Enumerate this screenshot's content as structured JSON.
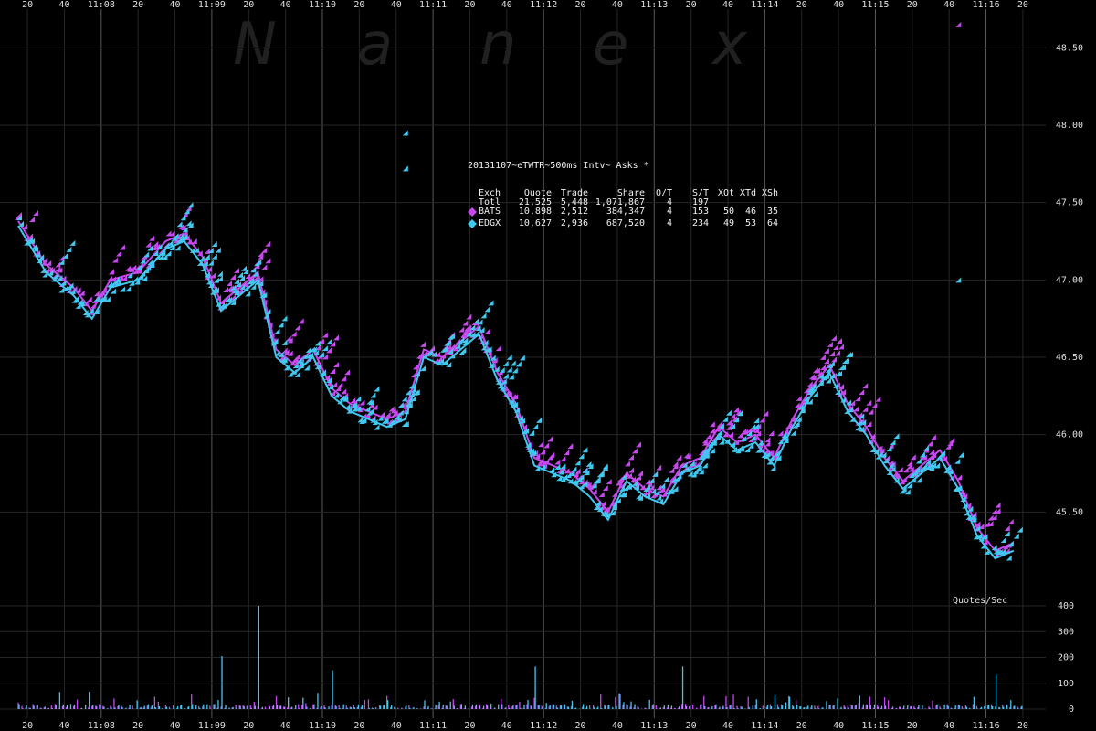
{
  "watermark": [
    "N",
    "a",
    "n",
    "e",
    "x"
  ],
  "chart_data": {
    "type": "scatter",
    "title": "20131107~eTWTR~500ms Intv~ Asks *",
    "price_axis": {
      "ticks": [
        "48.50",
        "48.00",
        "47.50",
        "47.00",
        "46.50",
        "46.00",
        "45.50"
      ],
      "range": [
        45.0,
        48.75
      ]
    },
    "volume_axis": {
      "label": "Quotes/Sec",
      "ticks": [
        "400",
        "300",
        "200",
        "100",
        "0"
      ],
      "range": [
        0,
        400
      ]
    },
    "time_axis": {
      "range": [
        "11:07:35",
        "11:16:45"
      ],
      "tick_labels": [
        "20",
        "40",
        "11:08",
        "20",
        "40",
        "11:09",
        "20",
        "40",
        "11:10",
        "20",
        "40",
        "11:11",
        "20",
        "40",
        "11:12",
        "20",
        "40",
        "11:13",
        "20",
        "40",
        "11:14",
        "20",
        "40",
        "11:15",
        "20",
        "40",
        "11:16",
        "20"
      ],
      "tick_times": [
        "11:07:40",
        "11:08:00",
        "11:08:20",
        "11:08:40",
        "11:09:00",
        "11:09:20",
        "11:09:40",
        "11:10:00",
        "11:10:20",
        "11:10:40",
        "11:11:00",
        "11:11:20",
        "11:11:40",
        "11:12:00",
        "11:12:20",
        "11:12:40",
        "11:13:00",
        "11:13:20",
        "11:13:40",
        "11:14:00",
        "11:14:20",
        "11:14:40",
        "11:15:00",
        "11:15:20",
        "11:15:40",
        "11:16:00",
        "11:16:20",
        "11:16:40"
      ]
    },
    "legend": {
      "header": [
        "Exch",
        "Quote",
        "Trade",
        "Share",
        "Q/T",
        "S/T",
        "XQt",
        "XTd",
        "XSh"
      ],
      "rows": [
        {
          "exch": "Totl",
          "quote": "21,525",
          "trade": "5,448",
          "share": "1,071,867",
          "qt": "4",
          "st": "197",
          "xqt": "",
          "xtd": "",
          "xsh": "",
          "color": ""
        },
        {
          "exch": "BATS",
          "quote": "10,898",
          "trade": "2,512",
          "share": "384,347",
          "qt": "4",
          "st": "153",
          "xqt": "50",
          "xtd": "46",
          "xsh": "35",
          "color": "#c848f0"
        },
        {
          "exch": "EDGX",
          "quote": "10,627",
          "trade": "2,936",
          "share": "687,520",
          "qt": "4",
          "st": "234",
          "xqt": "49",
          "xtd": "53",
          "xsh": "64",
          "color": "#40c8f0"
        }
      ]
    },
    "series": [
      {
        "name": "BATS",
        "color": "#c848f0",
        "points": [
          [
            "11:07:35",
            47.38
          ],
          [
            "11:07:50",
            47.1
          ],
          [
            "11:08:05",
            46.95
          ],
          [
            "11:08:15",
            46.8
          ],
          [
            "11:08:25",
            47.0
          ],
          [
            "11:08:40",
            47.05
          ],
          [
            "11:08:55",
            47.25
          ],
          [
            "11:09:05",
            47.3
          ],
          [
            "11:09:15",
            47.15
          ],
          [
            "11:09:25",
            46.85
          ],
          [
            "11:09:35",
            46.95
          ],
          [
            "11:09:45",
            47.05
          ],
          [
            "11:09:55",
            46.55
          ],
          [
            "11:10:05",
            46.45
          ],
          [
            "11:10:15",
            46.55
          ],
          [
            "11:10:25",
            46.3
          ],
          [
            "11:10:35",
            46.2
          ],
          [
            "11:10:45",
            46.15
          ],
          [
            "11:10:55",
            46.1
          ],
          [
            "11:11:05",
            46.15
          ],
          [
            "11:11:15",
            46.55
          ],
          [
            "11:11:25",
            46.5
          ],
          [
            "11:11:35",
            46.6
          ],
          [
            "11:11:45",
            46.7
          ],
          [
            "11:11:55",
            46.4
          ],
          [
            "11:12:05",
            46.2
          ],
          [
            "11:12:15",
            45.85
          ],
          [
            "11:12:25",
            45.8
          ],
          [
            "11:12:35",
            45.75
          ],
          [
            "11:12:45",
            45.65
          ],
          [
            "11:12:55",
            45.5
          ],
          [
            "11:13:05",
            45.75
          ],
          [
            "11:13:15",
            45.65
          ],
          [
            "11:13:25",
            45.6
          ],
          [
            "11:13:35",
            45.8
          ],
          [
            "11:13:45",
            45.85
          ],
          [
            "11:13:55",
            46.05
          ],
          [
            "11:14:05",
            45.95
          ],
          [
            "11:14:15",
            46.0
          ],
          [
            "11:14:25",
            45.85
          ],
          [
            "11:14:35",
            46.1
          ],
          [
            "11:14:45",
            46.3
          ],
          [
            "11:14:55",
            46.45
          ],
          [
            "11:15:05",
            46.2
          ],
          [
            "11:15:15",
            46.05
          ],
          [
            "11:15:25",
            45.85
          ],
          [
            "11:15:35",
            45.7
          ],
          [
            "11:15:45",
            45.8
          ],
          [
            "11:15:55",
            45.9
          ],
          [
            "11:16:05",
            45.7
          ],
          [
            "11:16:15",
            45.4
          ],
          [
            "11:16:25",
            45.25
          ],
          [
            "11:16:35",
            45.3
          ]
        ]
      },
      {
        "name": "EDGX",
        "color": "#40c8f0",
        "points": [
          [
            "11:07:35",
            47.35
          ],
          [
            "11:07:50",
            47.05
          ],
          [
            "11:08:05",
            46.9
          ],
          [
            "11:08:15",
            46.75
          ],
          [
            "11:08:25",
            46.95
          ],
          [
            "11:08:40",
            47.0
          ],
          [
            "11:08:55",
            47.2
          ],
          [
            "11:09:05",
            47.25
          ],
          [
            "11:09:15",
            47.1
          ],
          [
            "11:09:25",
            46.8
          ],
          [
            "11:09:35",
            46.9
          ],
          [
            "11:09:45",
            47.0
          ],
          [
            "11:09:55",
            46.5
          ],
          [
            "11:10:05",
            46.4
          ],
          [
            "11:10:15",
            46.5
          ],
          [
            "11:10:25",
            46.25
          ],
          [
            "11:10:35",
            46.15
          ],
          [
            "11:10:45",
            46.1
          ],
          [
            "11:10:55",
            46.05
          ],
          [
            "11:11:05",
            46.1
          ],
          [
            "11:11:15",
            46.5
          ],
          [
            "11:11:25",
            46.45
          ],
          [
            "11:11:35",
            46.55
          ],
          [
            "11:11:45",
            46.65
          ],
          [
            "11:11:55",
            46.35
          ],
          [
            "11:12:05",
            46.15
          ],
          [
            "11:12:15",
            45.8
          ],
          [
            "11:12:25",
            45.75
          ],
          [
            "11:12:35",
            45.7
          ],
          [
            "11:12:45",
            45.6
          ],
          [
            "11:12:55",
            45.45
          ],
          [
            "11:13:05",
            45.7
          ],
          [
            "11:13:15",
            45.6
          ],
          [
            "11:13:25",
            45.55
          ],
          [
            "11:13:35",
            45.75
          ],
          [
            "11:13:45",
            45.8
          ],
          [
            "11:13:55",
            46.0
          ],
          [
            "11:14:05",
            45.9
          ],
          [
            "11:14:15",
            45.95
          ],
          [
            "11:14:25",
            45.8
          ],
          [
            "11:14:35",
            46.05
          ],
          [
            "11:14:45",
            46.25
          ],
          [
            "11:14:55",
            46.4
          ],
          [
            "11:15:05",
            46.15
          ],
          [
            "11:15:15",
            46.0
          ],
          [
            "11:15:25",
            45.8
          ],
          [
            "11:15:35",
            45.65
          ],
          [
            "11:15:45",
            45.75
          ],
          [
            "11:15:55",
            45.85
          ],
          [
            "11:16:05",
            45.65
          ],
          [
            "11:16:15",
            45.35
          ],
          [
            "11:16:25",
            45.2
          ],
          [
            "11:16:35",
            45.25
          ]
        ]
      }
    ],
    "outliers": [
      {
        "series": "BATS",
        "t": "11:16:05",
        "y": 48.65
      },
      {
        "series": "EDGX",
        "t": "11:11:05",
        "y": 47.95
      },
      {
        "series": "EDGX",
        "t": "11:11:05",
        "y": 47.72
      },
      {
        "series": "EDGX",
        "t": "11:16:05",
        "y": 47.0
      }
    ],
    "quotes_per_sec": {
      "bucket_seconds": 5,
      "peaks": [
        {
          "t": "11:09:45",
          "value": 400
        },
        {
          "t": "11:09:25",
          "value": 205
        },
        {
          "t": "11:12:15",
          "value": 165
        },
        {
          "t": "11:13:35",
          "value": 165
        },
        {
          "t": "11:10:25",
          "value": 150
        },
        {
          "t": "11:16:25",
          "value": 135
        }
      ],
      "typical_range": [
        20,
        100
      ]
    },
    "grid": true
  }
}
